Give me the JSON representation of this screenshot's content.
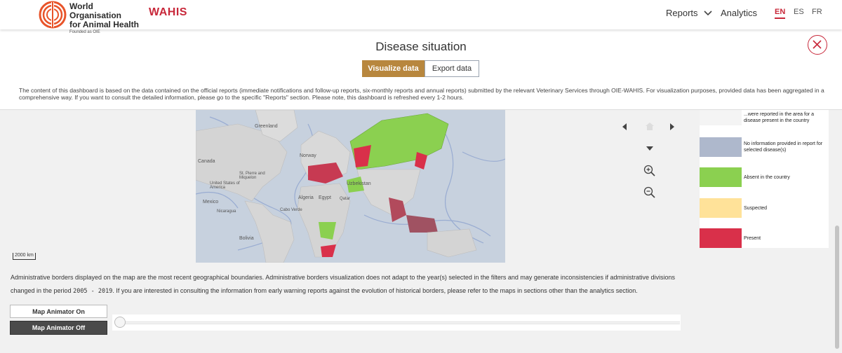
{
  "header": {
    "org_line1": "World Organisation",
    "org_line2": "for Animal Health",
    "org_line3": "Founded as OIE",
    "brand": "WAHIS",
    "nav": {
      "reports": "Reports",
      "analytics": "Analytics"
    },
    "languages": [
      "EN",
      "ES",
      "FR"
    ],
    "active_language": "EN",
    "accent_color": "#c8283a"
  },
  "page": {
    "title": "Disease situation",
    "buttons": {
      "visualize": "Visualize data",
      "export": "Export data"
    },
    "info_text": "The content of this dashboard is based on the data contained on the official reports (immediate notifications and follow-up reports, six-monthly reports and annual reports) submitted by the relevant Veterinary Services through OIE-WAHIS. For visualization purposes, provided data has been aggregated in a comprehensive way. If you want to consult the detailed information, please go to the specific \"Reports\" section. Please note, this dashboard is refreshed every 1-2 hours."
  },
  "map": {
    "labels": [
      "Greenland",
      "Norway",
      "Canada",
      "St. Pierre and Miquelon",
      "United States of America",
      "Mexico",
      "Nicaragua",
      "Cabo Verde",
      "Algeria",
      "Egypt",
      "Qatar",
      "Uzbekistan",
      "Bolivia"
    ],
    "scale": "2000 km"
  },
  "legend": {
    "items": [
      {
        "label": "...were reported in the area for a disease present in the country",
        "color": "#f4f4f4"
      },
      {
        "label": "No information provided in report for selected disease(s)",
        "color": "#aeb8cc"
      },
      {
        "label": "Absent in the country",
        "color": "#8bd050"
      },
      {
        "label": "Suspected",
        "color": "#ffe299"
      },
      {
        "label": "Present",
        "color": "#d9304a"
      }
    ]
  },
  "admin_note": {
    "text1": "Administrative borders displayed on the map are the most recent geographical boundaries. Administrative borders visualization does not adapt to the year(s) selected in the filters and may generate inconsistencies if administrative divisions changed in the period ",
    "period": "2005 - 2019",
    "text2": ". If you are interested in consulting the information from early warning reports against the evolution of historical borders, please refer to the maps in sections other than the analytics section."
  },
  "animator": {
    "on": "Map Animator On",
    "off": "Map Animator Off"
  }
}
